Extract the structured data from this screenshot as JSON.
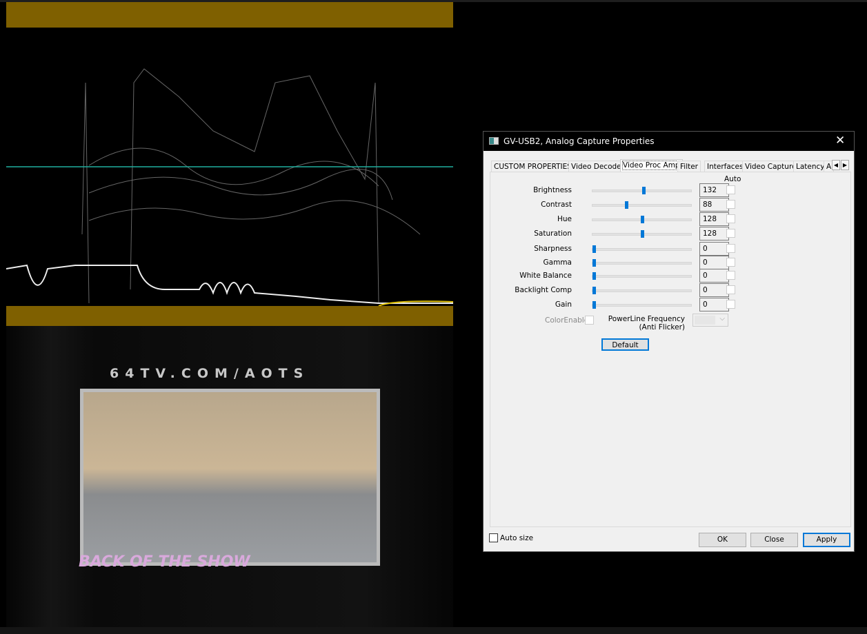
{
  "video": {
    "overlay_text": "64TV.COM/AOTS",
    "logo_text": "BACK OF THE SHOW"
  },
  "dialog": {
    "title": "GV-USB2, Analog Capture Properties",
    "tabs": [
      "CUSTOM PROPERTIES",
      "Video Decoder",
      "Video Proc Amp",
      "Filter",
      "Interfaces",
      "Video Capture",
      "Latency",
      "A"
    ],
    "selected_tab": "Video Proc Amp",
    "auto_header": "Auto",
    "slider_max": 255,
    "properties": [
      {
        "label": "Brightness",
        "value": "132",
        "num": 132
      },
      {
        "label": "Contrast",
        "value": "88",
        "num": 88
      },
      {
        "label": "Hue",
        "value": "128",
        "num": 128
      },
      {
        "label": "Saturation",
        "value": "128",
        "num": 128
      },
      {
        "label": "Sharpness",
        "value": "0",
        "num": 0
      },
      {
        "label": "Gamma",
        "value": "0",
        "num": 0
      },
      {
        "label": "White Balance",
        "value": "0",
        "num": 0
      },
      {
        "label": "Backlight Comp",
        "value": "0",
        "num": 0
      },
      {
        "label": "Gain",
        "value": "0",
        "num": 0
      }
    ],
    "color_enable": "ColorEnable",
    "powerline_label": "PowerLine Frequency",
    "powerline_sub": "(Anti Flicker)",
    "default_button": "Default",
    "auto_size": "Auto size",
    "ok": "OK",
    "close": "Close",
    "apply": "Apply"
  }
}
